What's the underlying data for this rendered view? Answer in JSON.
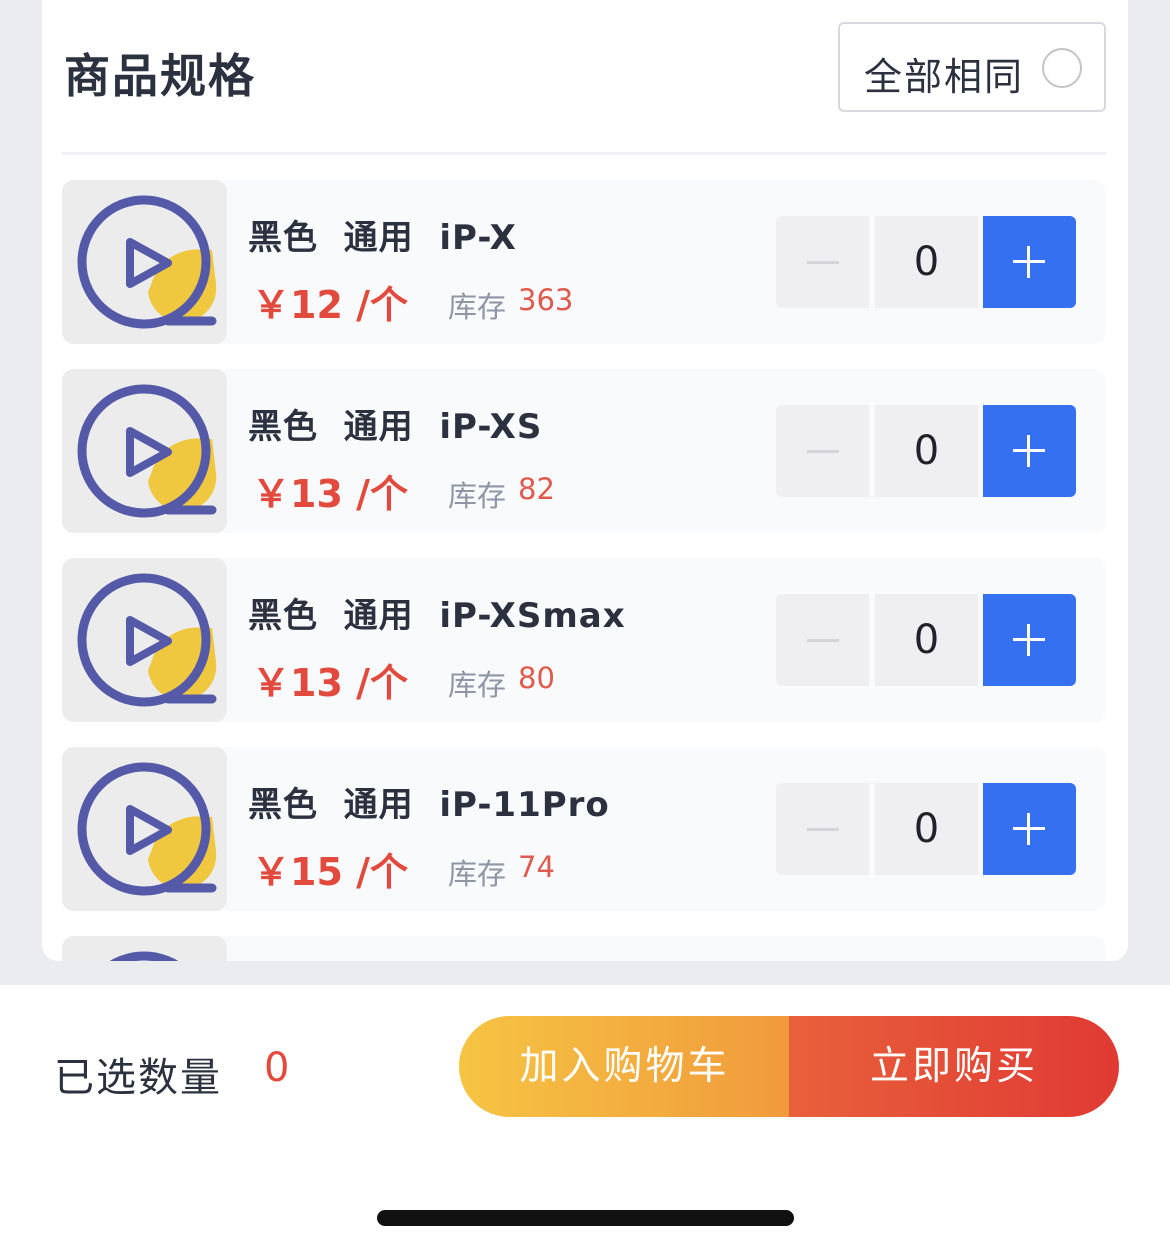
{
  "header": {
    "title": "商品规格",
    "all_same_label": "全部相同"
  },
  "skus": [
    {
      "name": "黑色  通用  iP-X",
      "price": "￥12 /个",
      "stock_label": "库存",
      "stock": "363",
      "qty": "0"
    },
    {
      "name": "黑色  通用  iP-XS",
      "price": "￥13 /个",
      "stock_label": "库存",
      "stock": "82",
      "qty": "0"
    },
    {
      "name": "黑色  通用  iP-XSmax",
      "price": "￥13 /个",
      "stock_label": "库存",
      "stock": "80",
      "qty": "0"
    },
    {
      "name": "黑色  通用  iP-11Pro",
      "price": "￥15 /个",
      "stock_label": "库存",
      "stock": "74",
      "qty": "0"
    }
  ],
  "footer": {
    "selected_label": "已选数量",
    "selected_count": "0",
    "add_to_cart": "加入购物车",
    "buy_now": "立即购买"
  },
  "colors": {
    "accent_blue": "#3570f1",
    "price_red": "#e14a3c",
    "cart_gradient_start": "#f6c443",
    "cart_gradient_end": "#f19a3c",
    "buy_gradient_start": "#e8603b",
    "buy_gradient_end": "#e03a33"
  }
}
